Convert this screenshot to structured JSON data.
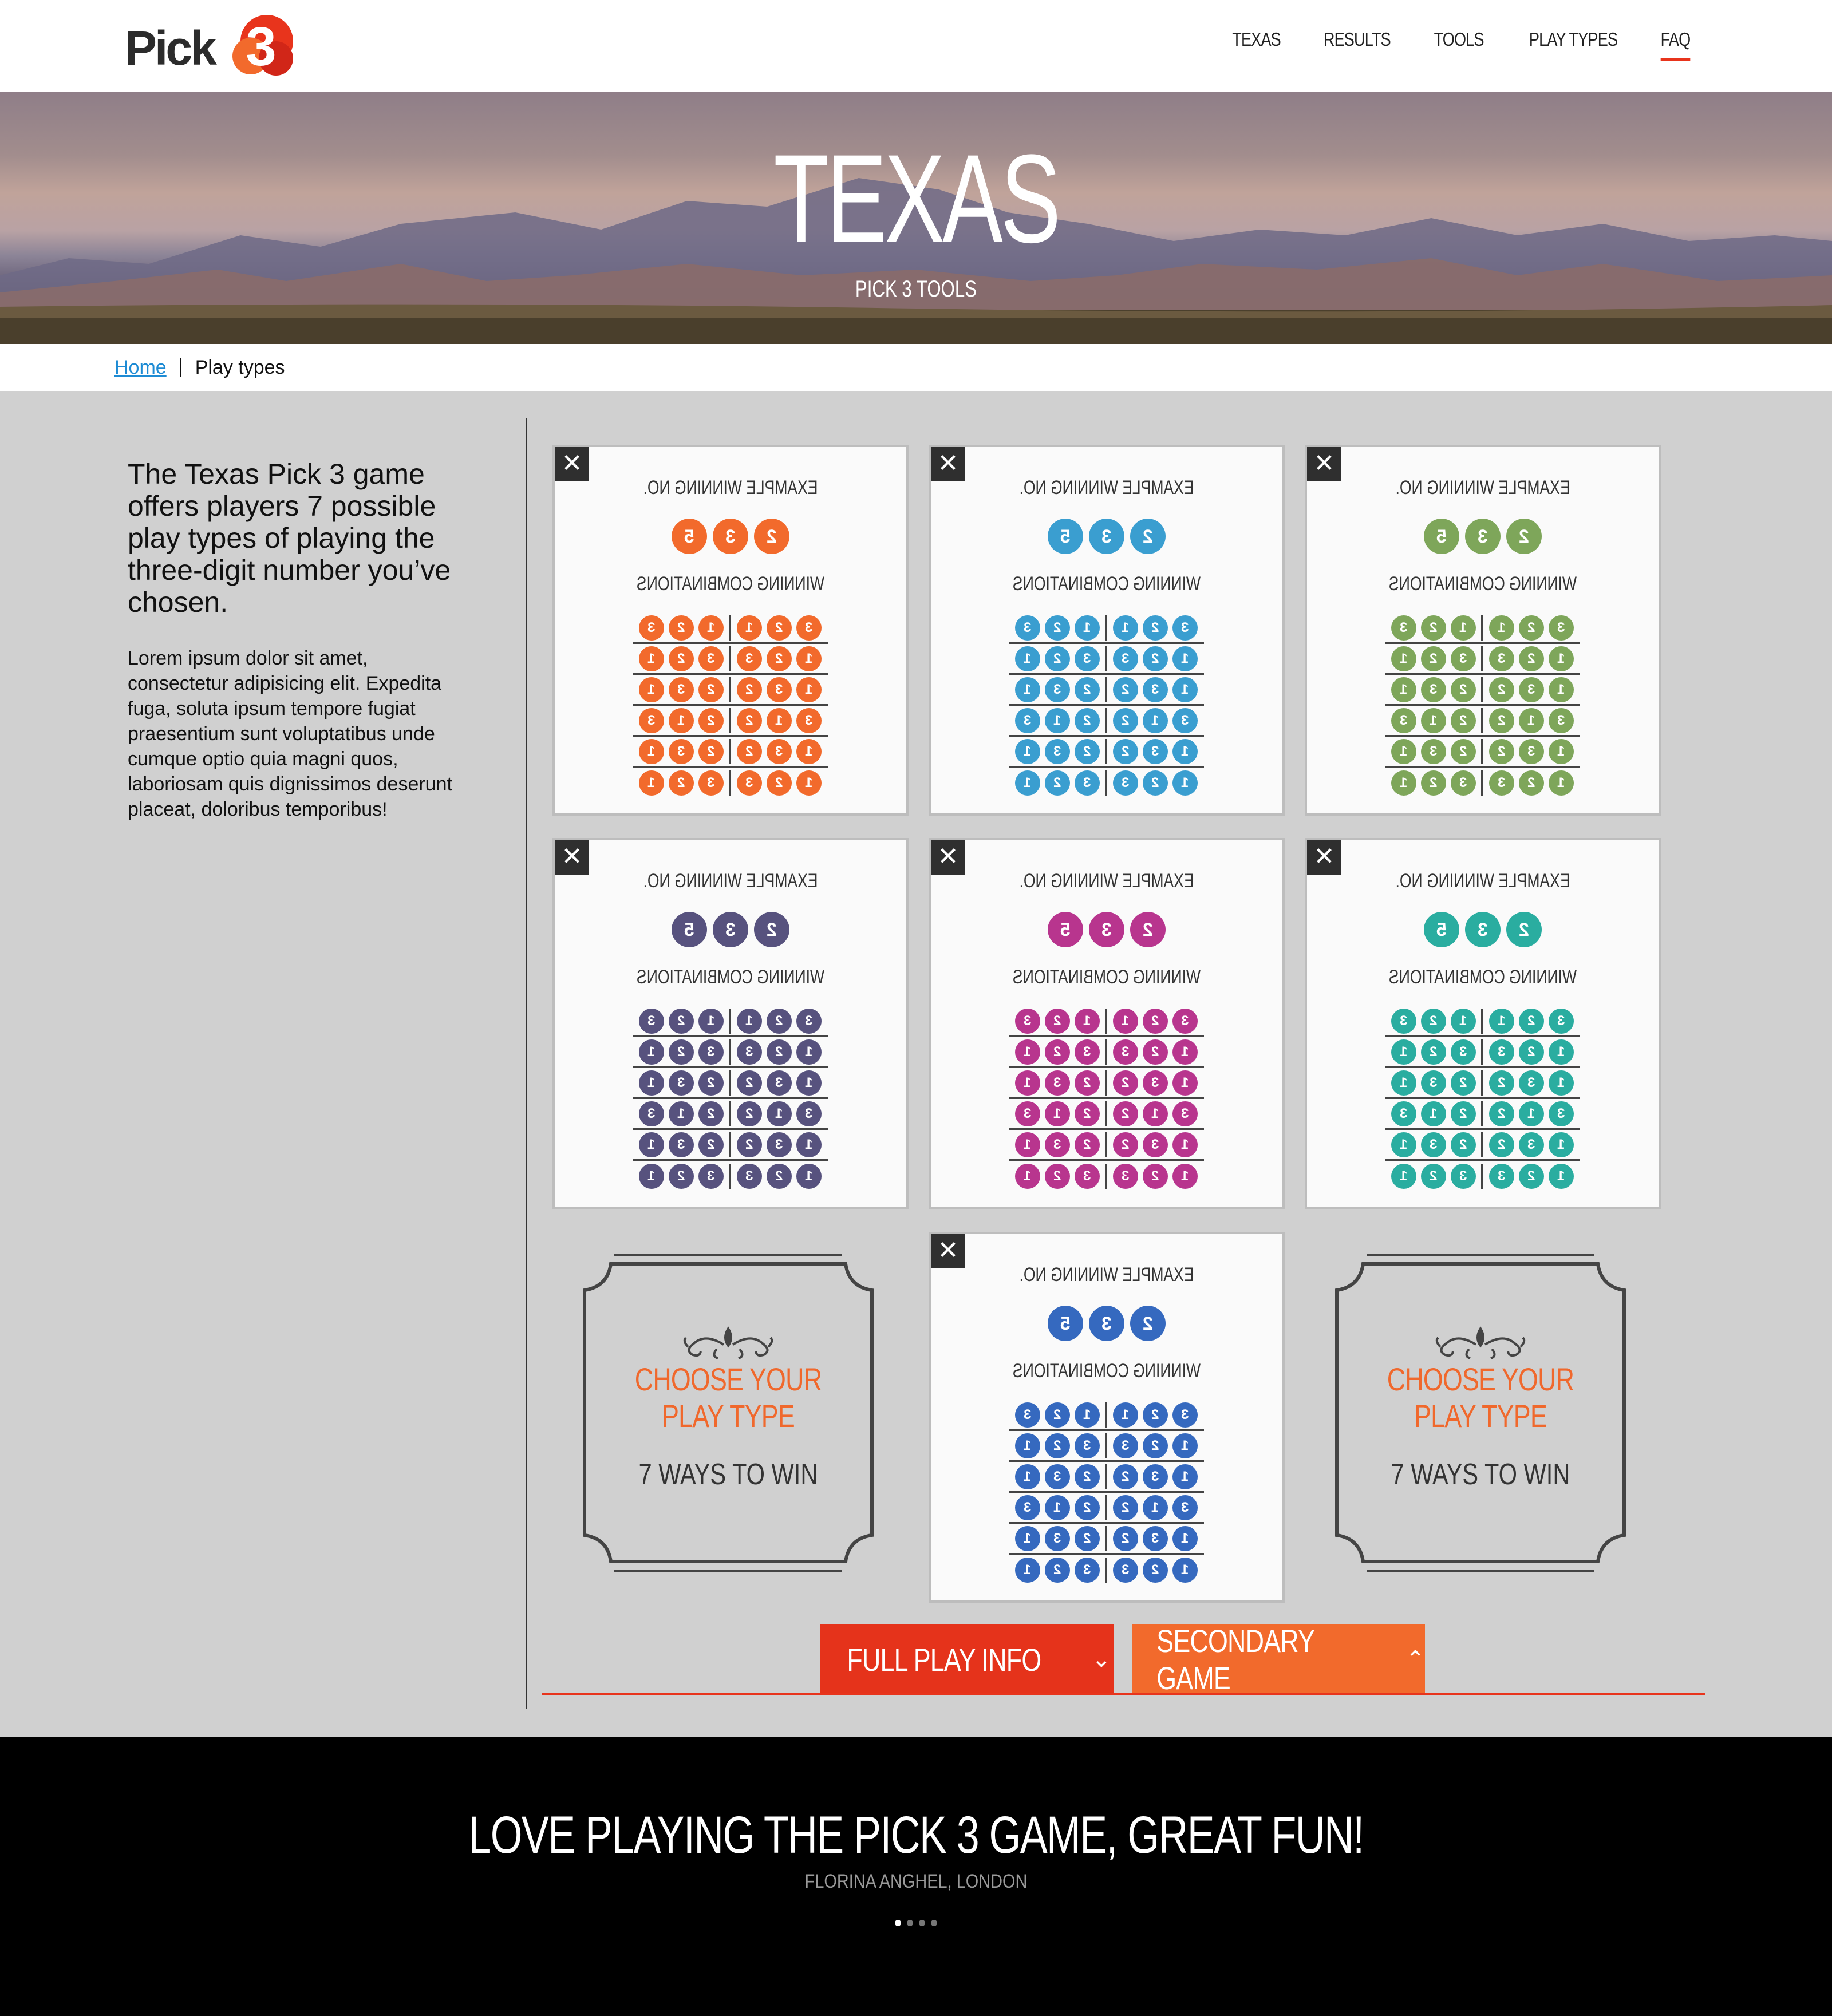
{
  "logo": {
    "text": "Pick",
    "digit": "3"
  },
  "nav": [
    {
      "label": "TEXAS"
    },
    {
      "label": "RESULTS"
    },
    {
      "label": "TOOLS"
    },
    {
      "label": "PLAY TYPES"
    },
    {
      "label": "FAQ",
      "active": true
    }
  ],
  "hero": {
    "title": "TEXAS",
    "subtitle": "PICK 3 TOOLS"
  },
  "breadcrumb": {
    "home": "Home",
    "current": "Play types"
  },
  "intro": {
    "heading": "The Texas Pick 3 game offers players 7 possible play types of playing the three-digit number you’ve chosen.",
    "body": "Lorem ipsum dolor sit amet, consectetur adipisicing elit. Expedita fuga, soluta ipsum tempore fugiat praesentium sunt voluptatibus unde cumque optio quia magni quos, laboriosam quis dignissimos deserunt placeat, doloribus temporibus!"
  },
  "card_text": {
    "close": "✕",
    "example_label": "EXAMPLE WINNING NO.",
    "combos_label": "WINNING COMBINATIONS"
  },
  "example_number": [
    "5",
    "3",
    "2"
  ],
  "combinations": [
    [
      [
        "3",
        "2",
        "1"
      ],
      [
        "1",
        "2",
        "3"
      ]
    ],
    [
      [
        "1",
        "2",
        "3"
      ],
      [
        "3",
        "2",
        "1"
      ]
    ],
    [
      [
        "1",
        "3",
        "2"
      ],
      [
        "2",
        "3",
        "1"
      ]
    ],
    [
      [
        "3",
        "1",
        "2"
      ],
      [
        "2",
        "1",
        "3"
      ]
    ],
    [
      [
        "1",
        "3",
        "2"
      ],
      [
        "2",
        "3",
        "1"
      ]
    ],
    [
      [
        "1",
        "2",
        "3"
      ],
      [
        "3",
        "2",
        "1"
      ]
    ]
  ],
  "cards": [
    {
      "color": "#f26a2c"
    },
    {
      "color": "#3a9ed0"
    },
    {
      "color": "#7ea65a"
    },
    {
      "color": "#57527e"
    },
    {
      "color": "#b8358e"
    },
    {
      "color": "#2aada0"
    },
    {
      "color": "#3569bf"
    }
  ],
  "promo": {
    "title_line1": "CHOOSE YOUR",
    "title_line2": "PLAY TYPE",
    "subtitle": "7 WAYS TO WIN"
  },
  "buttons": {
    "full_play_info": "FULL PLAY INFO",
    "secondary_game": "SECONDARY GAME"
  },
  "colors": {
    "accent_red": "#e8341c",
    "accent_orange": "#f26a2c",
    "primary_button": "#e5331b",
    "secondary_button": "#f26a2c"
  },
  "testimonial": {
    "quote": "LOVE PLAYING THE PICK 3 GAME, GREAT FUN!",
    "author": "FLORINA ANGHEL, LONDON"
  }
}
